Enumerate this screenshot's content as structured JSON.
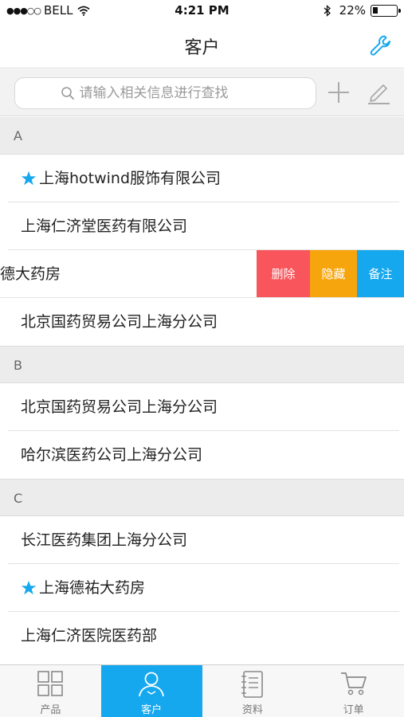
{
  "status_bar": {
    "signal": "●●●○○",
    "carrier": "BELL",
    "time": "4:21 PM",
    "battery_percent": "22%",
    "battery_level": 0.22
  },
  "nav": {
    "title": "客户",
    "settings_icon": "wrench-icon"
  },
  "search": {
    "placeholder": "请输入相关信息进行查找"
  },
  "sections": [
    {
      "letter": "A",
      "rows": [
        {
          "name": "上海hotwind服饰有限公司",
          "starred": true
        },
        {
          "name": "上海仁济堂医药有限公司",
          "starred": false
        },
        {
          "name": "德大药房",
          "starred": false,
          "swiped": true
        },
        {
          "name": "北京国药贸易公司上海分公司",
          "starred": false
        }
      ]
    },
    {
      "letter": "B",
      "rows": [
        {
          "name": "北京国药贸易公司上海分公司",
          "starred": false
        },
        {
          "name": "哈尔滨医药公司上海分公司",
          "starred": false
        }
      ]
    },
    {
      "letter": "C",
      "rows": [
        {
          "name": "长江医药集团上海分公司",
          "starred": false
        },
        {
          "name": "上海德祐大药房",
          "starred": true
        },
        {
          "name": "上海仁济医院医药部",
          "starred": false
        }
      ]
    }
  ],
  "swipe_actions": {
    "delete": "删除",
    "hide": "隐藏",
    "note": "备注"
  },
  "tabs": [
    {
      "label": "产品",
      "icon": "grid-icon",
      "active": false
    },
    {
      "label": "客户",
      "icon": "person-icon",
      "active": true
    },
    {
      "label": "资料",
      "icon": "notebook-icon",
      "active": false
    },
    {
      "label": "订单",
      "icon": "cart-icon",
      "active": false
    }
  ],
  "colors": {
    "accent": "#16a8ee",
    "delete": "#f9555c",
    "hide": "#f7a50d",
    "star": "#16a8ee"
  }
}
